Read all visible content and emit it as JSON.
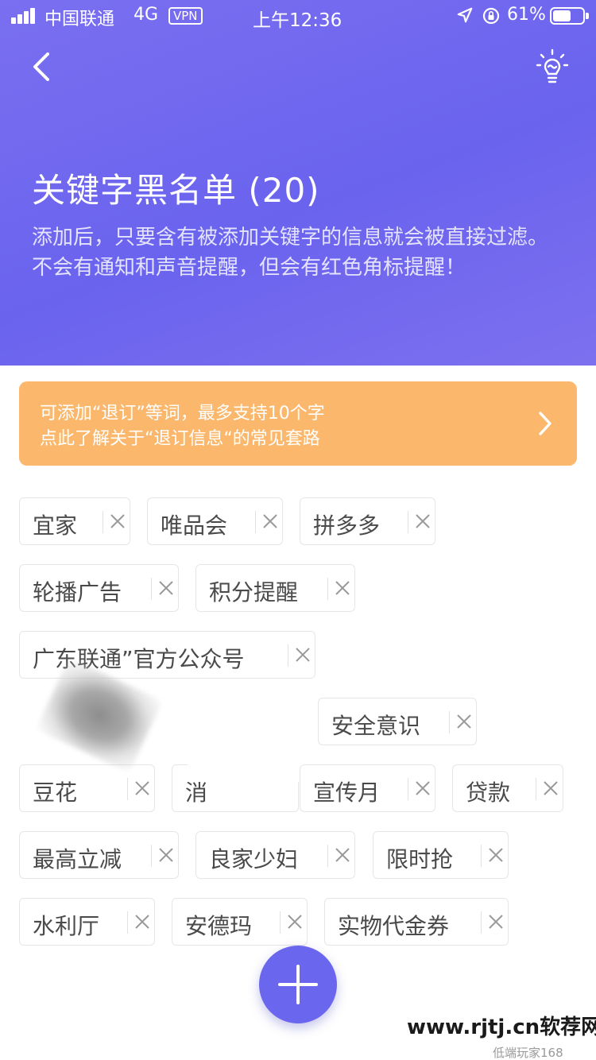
{
  "status_bar": {
    "carrier": "中国联通",
    "network": "4G",
    "vpn": "VPN",
    "time": "上午12:36",
    "battery_percent": "61%",
    "battery_level": 0.61
  },
  "header": {
    "back_icon": "chevron-left-icon",
    "help_icon": "lightbulb-icon",
    "title": "关键字黑名单 (20)",
    "description": "添加后，只要含有被添加关键字的信息就会被直接过滤。不会有通知和声音提醒，但会有红色角标提醒！"
  },
  "tip": {
    "line1": "可添加“退订”等词，最多支持10个字",
    "line2": "点此了解关于“退订信息“的常见套路",
    "arrow_icon": "chevron-right-icon"
  },
  "tags": [
    "宜家",
    "唯品会",
    "拼多多",
    "轮播广告",
    "积分提醒",
    "广东联通”官方公众号",
    "安全意识",
    "豆花",
    "消",
    "宣传月",
    "贷款",
    "最高立减",
    "良家少妇",
    "限时抢",
    "水利厅",
    "安德玛",
    "实物代金券"
  ],
  "colors": {
    "header_gradient_start": "#7a6ff0",
    "header_gradient_end": "#6a63ee",
    "tip_background": "#fbb86c",
    "fab_background": "#6b66ee"
  },
  "fab": {
    "icon": "plus-icon"
  },
  "watermark": {
    "text": "www.rjtj.cn软荐网",
    "sub": "低端玩家168"
  }
}
